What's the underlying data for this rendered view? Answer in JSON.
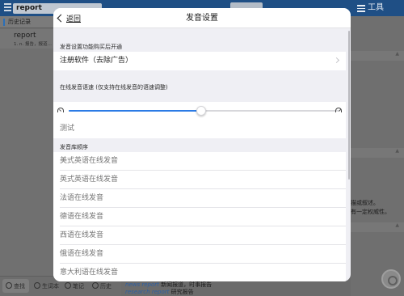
{
  "app": {
    "search_query": "report",
    "segments": [
      "",
      ""
    ],
    "tools_label": "工具",
    "history_title": "历史记录",
    "history_items": [
      {
        "word": "report",
        "definition": "1. n. 报告，报道…"
      }
    ],
    "right_panel_text": [
      "描或叙述。",
      "有一定权威性。"
    ],
    "examples": [
      {
        "en": "news report",
        "zh": "新闻报道，时事报告"
      },
      {
        "en": "research report",
        "zh": "研究报告"
      }
    ],
    "bottom_tabs": [
      "查找",
      "生词本",
      "笔记",
      "历史"
    ]
  },
  "modal": {
    "back_label": "返回",
    "title": "发音设置",
    "purchase_section": {
      "header": "发音设置功能购买后开通",
      "register_label": "注册软件（去除广告）"
    },
    "speed_section": {
      "header": "在线发音语速 (仅支持在线发音的语速调整)",
      "speed_value_percent": 49,
      "test_label": "测试"
    },
    "library_section": {
      "header": "发音库顺序",
      "items": [
        "美式英语在线发音",
        "英式英语在线发音",
        "法语在线发音",
        "德语在线发音",
        "西语在线发音",
        "俄语在线发音",
        "意大利语在线发音"
      ]
    }
  },
  "colors": {
    "accent": "#2c7be5",
    "nav_bar": "#1f4f85"
  }
}
